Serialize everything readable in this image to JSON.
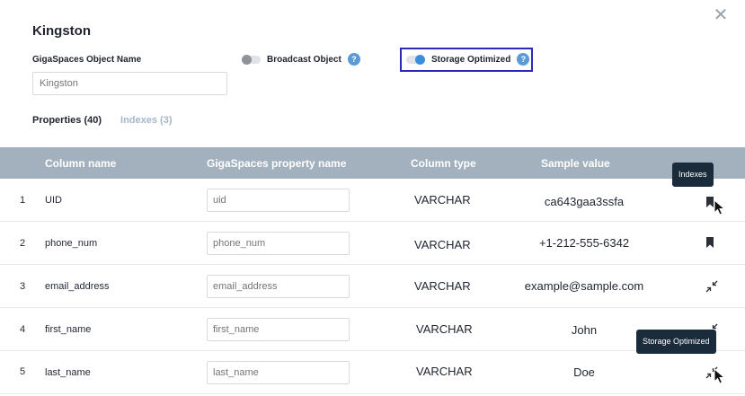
{
  "dialog": {
    "title": "Kingston",
    "close_glyph": "✕"
  },
  "form": {
    "object_name_label": "GigaSpaces Object Name",
    "object_name_value": "Kingston",
    "broadcast_label": "Broadcast Object",
    "broadcast_on": false,
    "storage_label": "Storage Optimized",
    "storage_on": true,
    "help_glyph": "?"
  },
  "tabs": [
    {
      "label": "Properties (40)",
      "active": true
    },
    {
      "label": "Indexes (3)",
      "active": false
    }
  ],
  "table": {
    "headers": [
      "Column name",
      "GigaSpaces property name",
      "Column type",
      "Sample value"
    ],
    "rows": [
      {
        "index": "1",
        "column_name": "UID",
        "property_placeholder": "uid",
        "column_type": "VARCHAR",
        "sample": "ca643gaa3ssfa",
        "action_icon": "bookmark-icon"
      },
      {
        "index": "2",
        "column_name": "phone_num",
        "property_placeholder": "phone_num",
        "column_type": "VARCHAR",
        "sample": "+1-212-555-6342",
        "action_icon": "bookmark-icon"
      },
      {
        "index": "3",
        "column_name": "email_address",
        "property_placeholder": "email_address",
        "column_type": "VARCHAR",
        "sample": "example@sample.com",
        "action_icon": "compress-icon"
      },
      {
        "index": "4",
        "column_name": "first_name",
        "property_placeholder": "first_name",
        "column_type": "VARCHAR",
        "sample": "John",
        "action_icon": "compress-icon"
      },
      {
        "index": "5",
        "column_name": "last_name",
        "property_placeholder": "last_name",
        "column_type": "VARCHAR",
        "sample": "Doe",
        "action_icon": "compress-icon"
      }
    ]
  },
  "tooltips": {
    "indexes": "Indexes",
    "storage": "Storage Optimized"
  },
  "colors": {
    "header_bg": "#a3b1be",
    "highlight_border": "#2b2bb8",
    "tooltip_bg": "#1a2b3c",
    "help_icon": "#5b9bd5"
  }
}
